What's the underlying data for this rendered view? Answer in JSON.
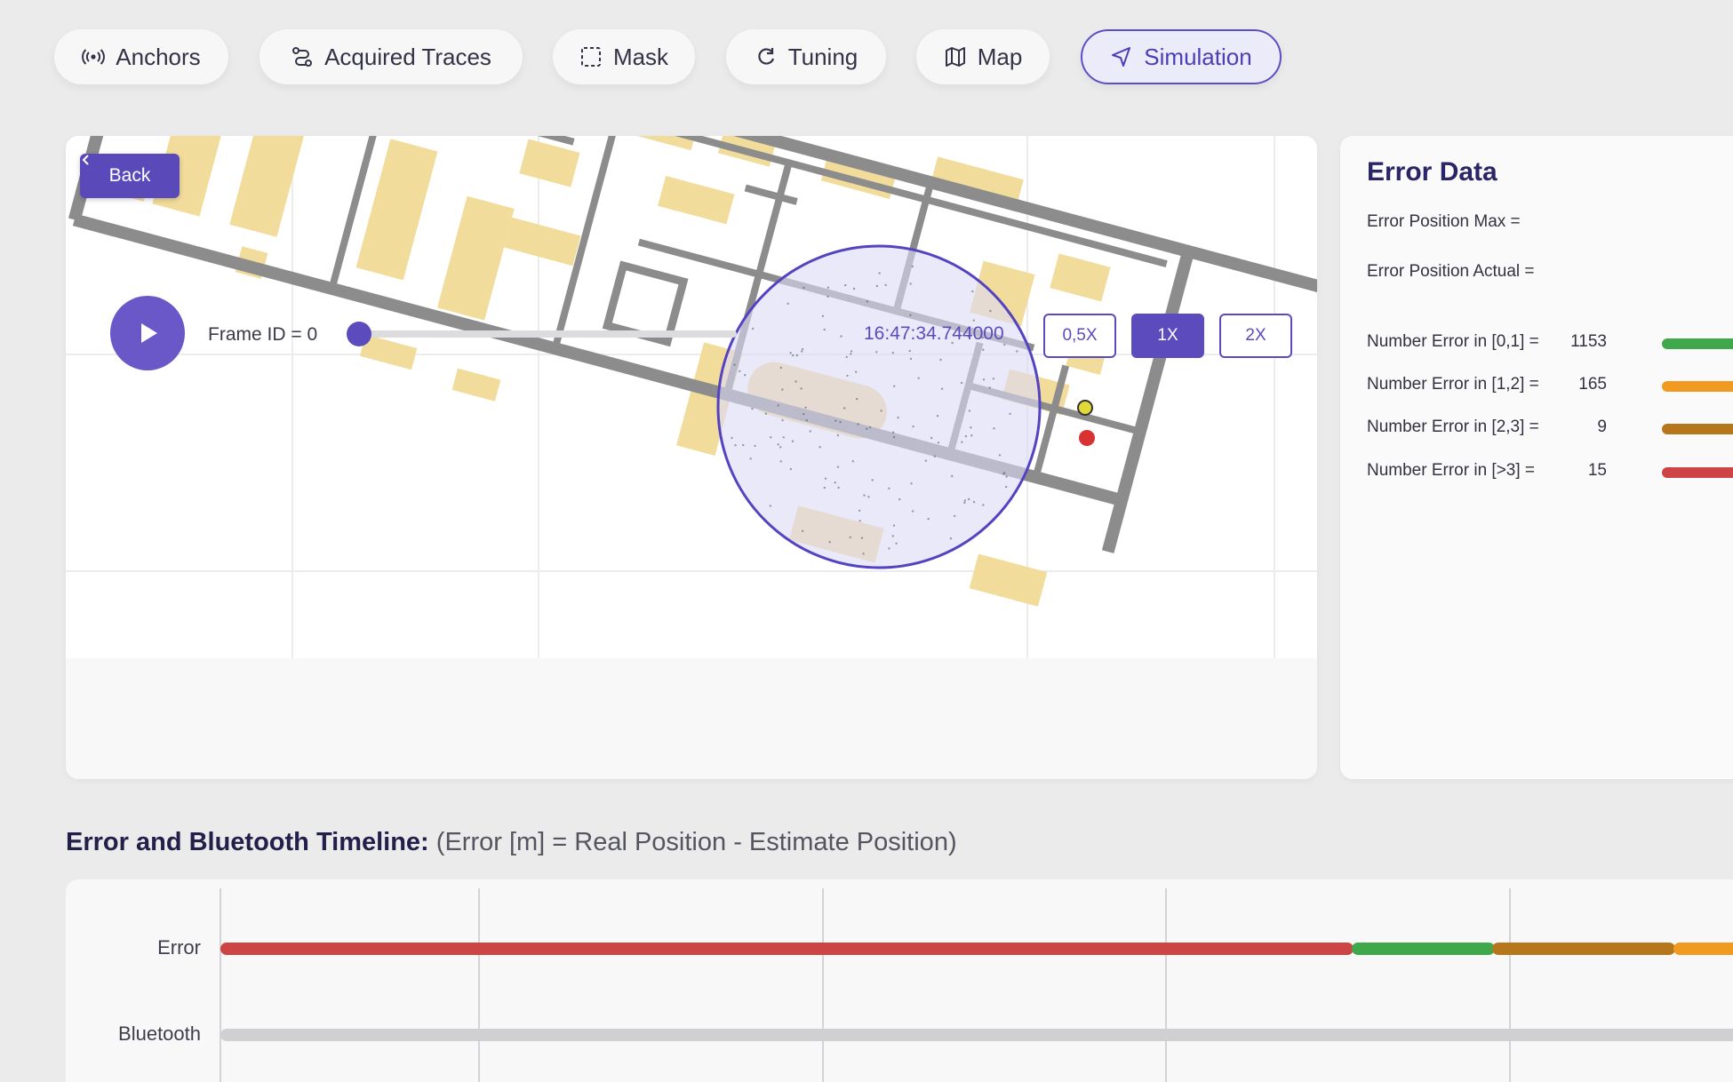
{
  "tabs": [
    {
      "label": "Anchors",
      "icon": "broadcast-icon",
      "active": false
    },
    {
      "label": "Acquired Traces",
      "icon": "route-icon",
      "active": false
    },
    {
      "label": "Mask",
      "icon": "dashed-square-icon",
      "active": false
    },
    {
      "label": "Tuning",
      "icon": "refresh-icon",
      "active": false
    },
    {
      "label": "Map",
      "icon": "map-icon",
      "active": false
    },
    {
      "label": "Simulation",
      "icon": "navigation-arrow-icon",
      "active": true
    }
  ],
  "map": {
    "back_label": "Back"
  },
  "player": {
    "frame_label": "Frame ID = 0",
    "progress": 0,
    "timestamp": "16:47:34.744000",
    "speeds": [
      {
        "label": "0,5X",
        "active": false
      },
      {
        "label": "1X",
        "active": true
      },
      {
        "label": "2X",
        "active": false
      }
    ]
  },
  "error_data": {
    "title": "Error Data",
    "max_label": "Error Position Max =",
    "actual_label": "Error Position Actual =",
    "ranges": [
      {
        "label": "Number Error in [0,1] =",
        "value": "1153",
        "color": "#3fa84a"
      },
      {
        "label": "Number Error in [1,2] =",
        "value": "165",
        "color": "#f19a22"
      },
      {
        "label": "Number Error in [2,3] =",
        "value": "9",
        "color": "#b5761c"
      },
      {
        "label": "Number Error in [>3] =",
        "value": "15",
        "color": "#cc4444"
      }
    ]
  },
  "timeline": {
    "title_bold": "Error and Bluetooth Timeline:",
    "title_note": "(Error [m] = Real Position - Estimate Position)",
    "rows": [
      {
        "label": "Error"
      },
      {
        "label": "Bluetooth"
      }
    ]
  },
  "colors": {
    "accent": "#5b4bbd",
    "error_red": "#cc4444",
    "error_green": "#3fa84a",
    "error_brown": "#b5761c",
    "error_orange": "#f19a22"
  }
}
